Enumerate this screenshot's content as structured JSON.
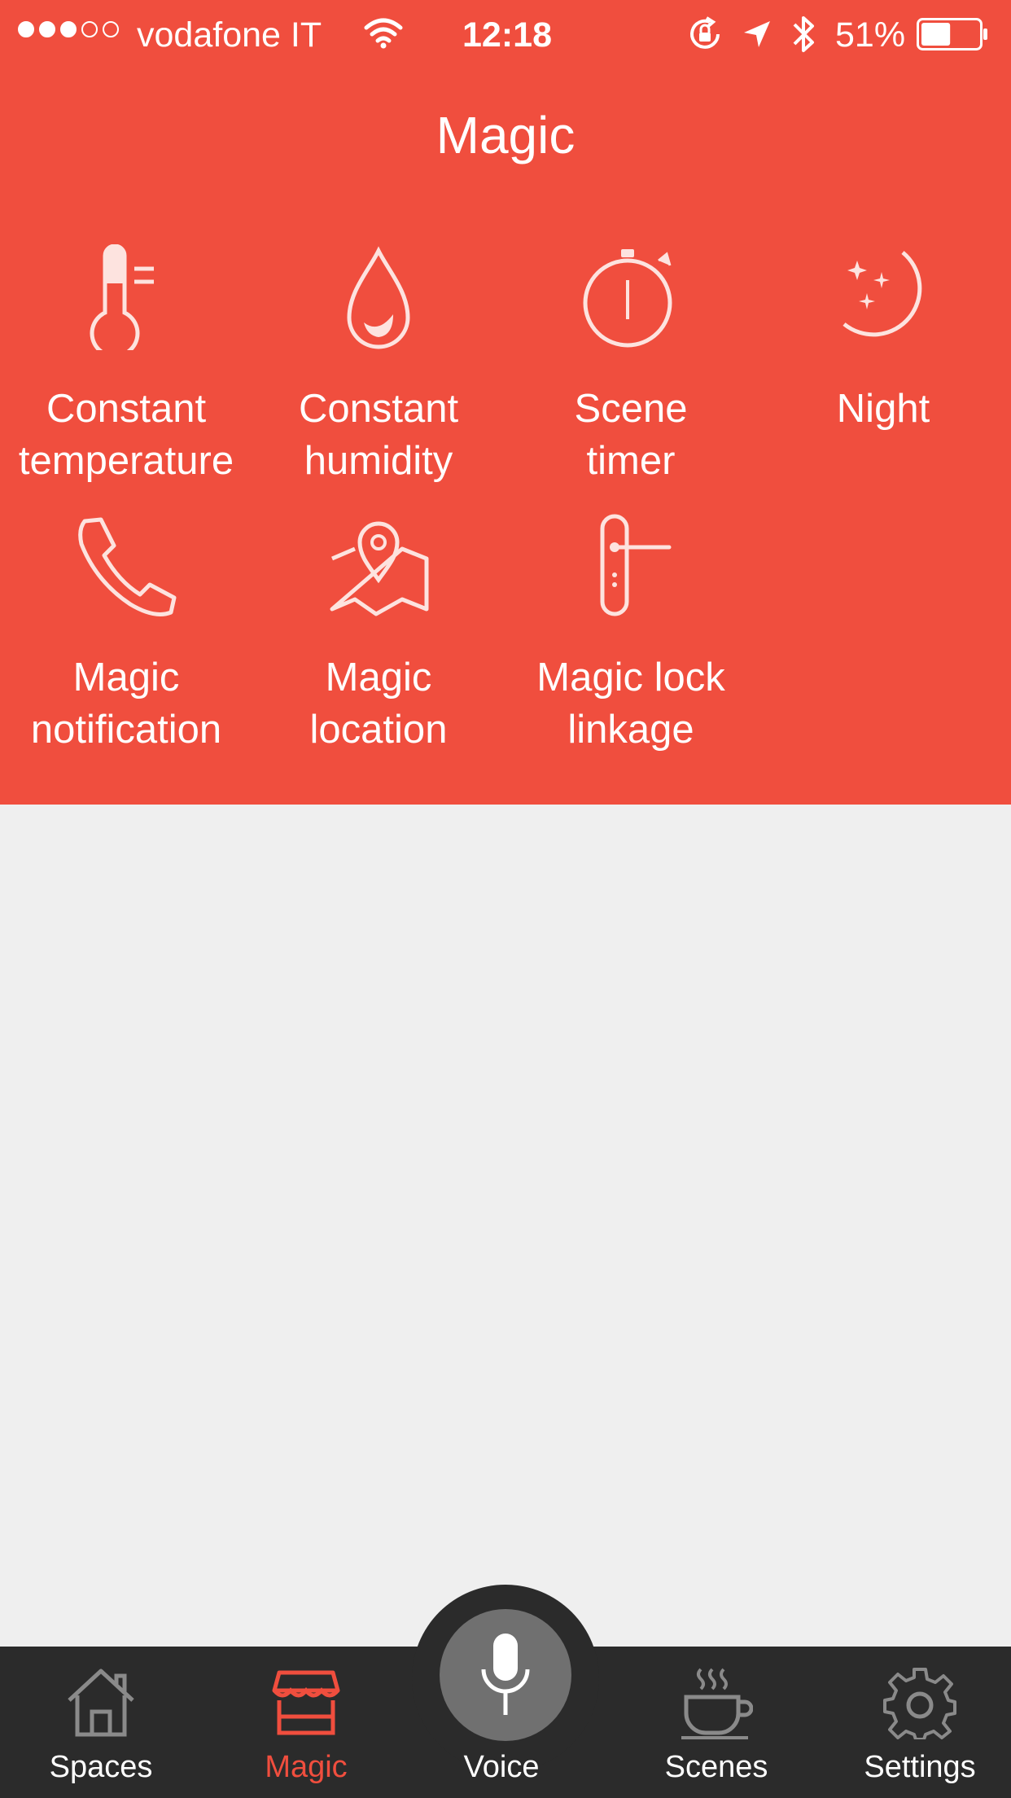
{
  "status_bar": {
    "carrier": "vodafone IT",
    "time": "12:18",
    "battery_percent": "51%",
    "battery_level": 0.51,
    "signal_bars_filled": 3,
    "signal_bars_total": 5
  },
  "header": {
    "title": "Magic"
  },
  "features": [
    {
      "label": "Constant\ntemperature",
      "icon": "thermometer-icon"
    },
    {
      "label": "Constant\nhumidity",
      "icon": "droplet-icon"
    },
    {
      "label": "Scene\ntimer",
      "icon": "stopwatch-icon"
    },
    {
      "label": "Night",
      "icon": "moon-stars-icon"
    },
    {
      "label": "Magic\nnotification",
      "icon": "phone-icon"
    },
    {
      "label": "Magic\nlocation",
      "icon": "map-pin-icon"
    },
    {
      "label": "Magic lock\nlinkage",
      "icon": "door-handle-icon"
    }
  ],
  "tabs": [
    {
      "label": "Spaces",
      "icon": "house-icon",
      "active": false
    },
    {
      "label": "Magic",
      "icon": "shop-icon",
      "active": true
    },
    {
      "label": "Voice",
      "icon": "microphone-icon",
      "active": false
    },
    {
      "label": "Scenes",
      "icon": "coffee-cup-icon",
      "active": false
    },
    {
      "label": "Settings",
      "icon": "gear-icon",
      "active": false
    }
  ],
  "colors": {
    "accent": "#f04e3e",
    "tab_bar": "#2b2b2b",
    "voice_button": "#707070",
    "background": "#efefef",
    "icon_light": "#fde3df"
  }
}
